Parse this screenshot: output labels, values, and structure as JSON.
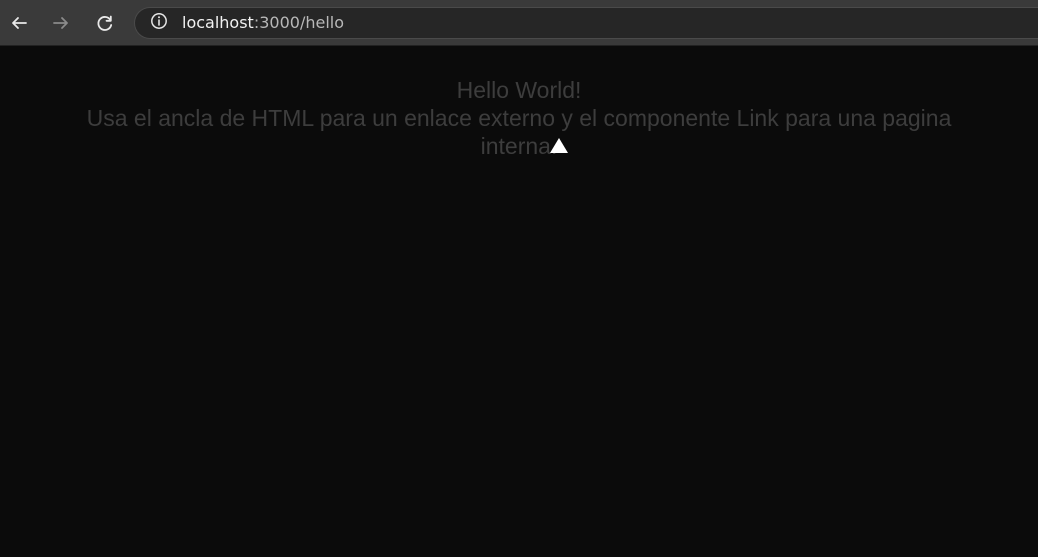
{
  "browser": {
    "nav": {
      "back_icon": "arrow-left-icon",
      "forward_icon": "arrow-right-icon",
      "reload_icon": "reload-icon"
    },
    "address": {
      "info_icon": "info-circle-icon",
      "host": "localhost",
      "path": ":3000/hello"
    }
  },
  "page": {
    "title": "Hello World!",
    "description": "Usa el ancla de HTML para un enlace externo y el componente Link para una pagina interna.",
    "marker_icon": "triangle-up-icon"
  },
  "colors": {
    "page_background": "#0b0b0b",
    "browser_toolbar": "#3a3a3a",
    "address_bar": "#262626",
    "content_text": "#3d3d3d"
  }
}
